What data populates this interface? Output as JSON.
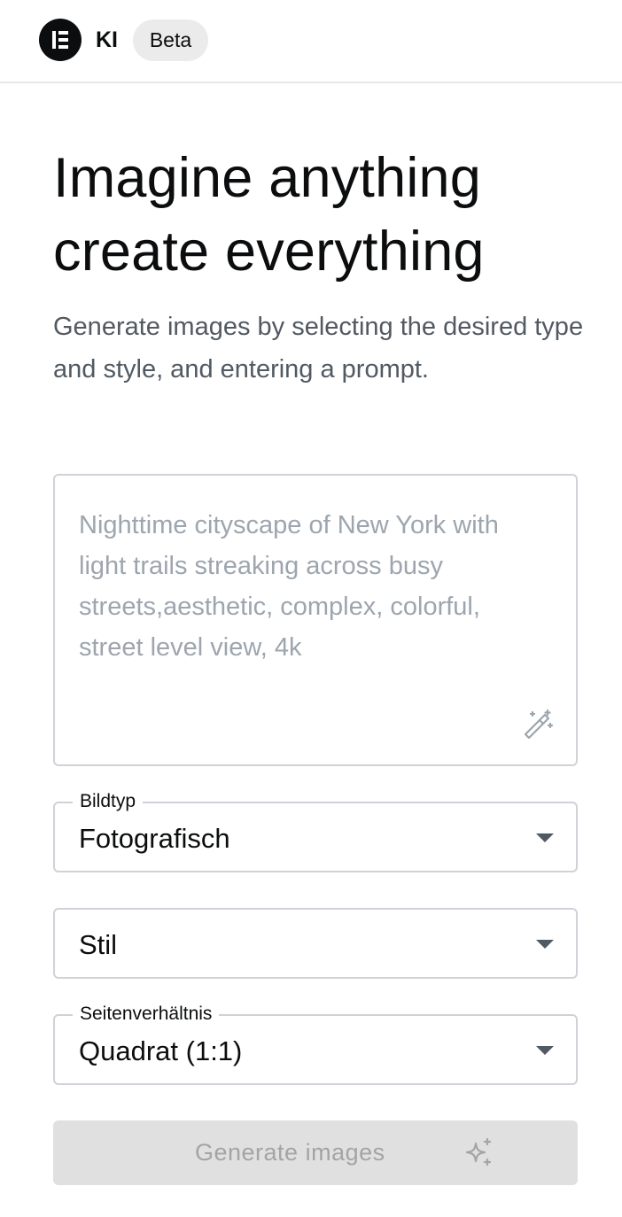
{
  "header": {
    "logo_icon": "elementor-logo-icon",
    "app_name": "KI",
    "badge": "Beta"
  },
  "hero": {
    "title_line1": "Imagine anything",
    "title_line2": "create everything",
    "subtitle": "Generate images by selecting the desired type and style, and entering a prompt."
  },
  "prompt": {
    "value": "",
    "placeholder": "Nighttime cityscape of New York with light trails streaking across busy streets,aesthetic, complex, colorful, street level view, 4k",
    "enhance_icon": "magic-wand-icon"
  },
  "selects": {
    "image_type": {
      "label": "Bildtyp",
      "value": "Fotografisch"
    },
    "style": {
      "label": "",
      "value": "Stil"
    },
    "aspect_ratio": {
      "label": "Seitenverhältnis",
      "value": "Quadrat (1:1)"
    }
  },
  "generate": {
    "label": "Generate images",
    "icon": "sparkle-icon",
    "disabled": true
  },
  "colors": {
    "text_primary": "#0c0d0e",
    "text_secondary": "#515962",
    "placeholder": "#9da5ae",
    "border": "#cfd2d6",
    "button_disabled_bg": "#e0e0e0",
    "badge_bg": "#ebebeb"
  }
}
